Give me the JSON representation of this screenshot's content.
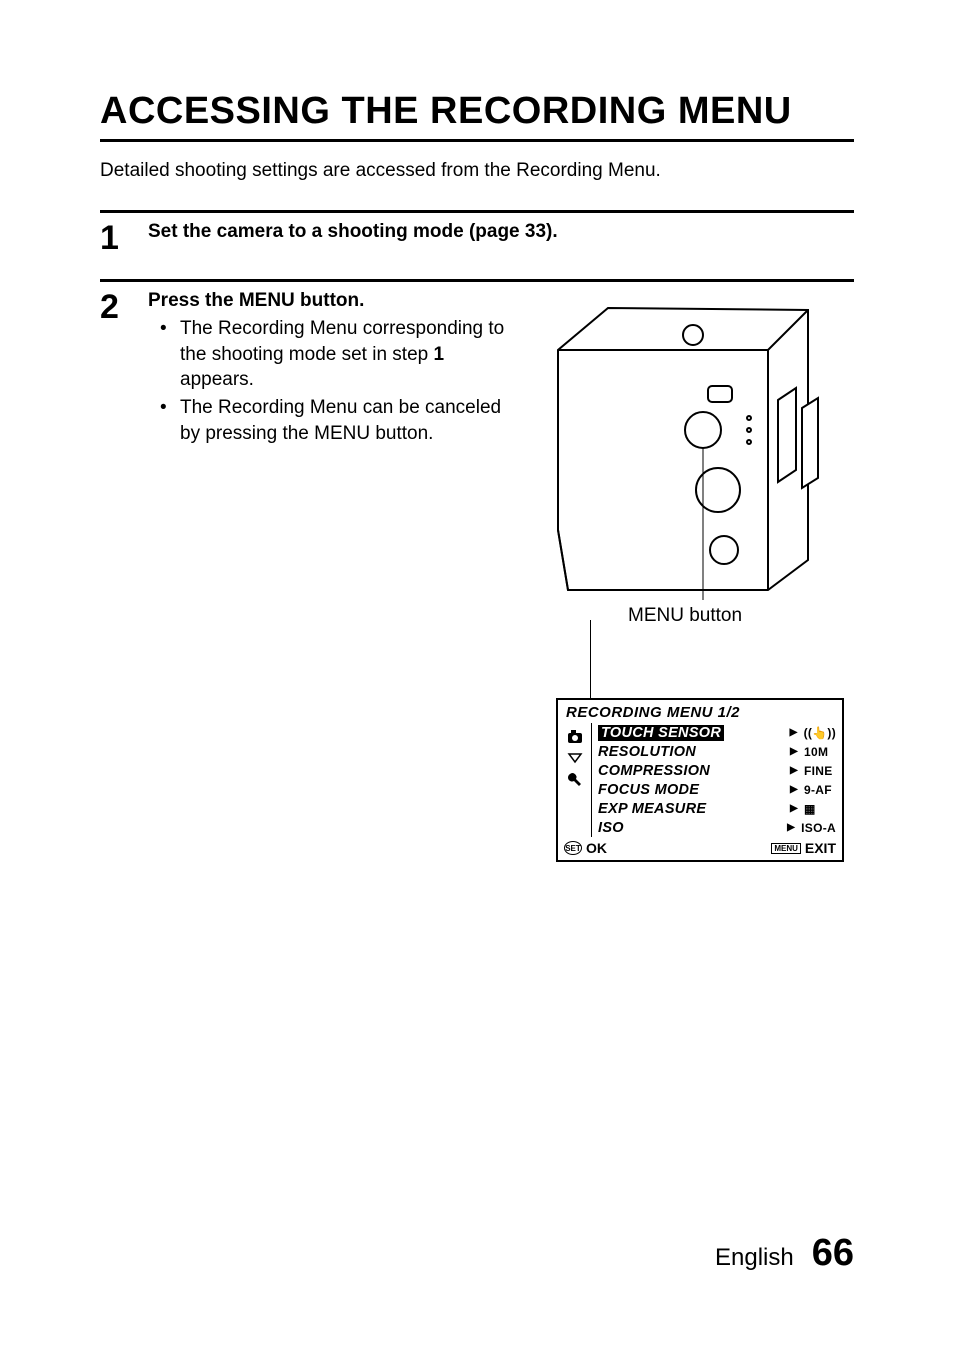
{
  "title": "ACCESSING THE RECORDING MENU",
  "intro": "Detailed shooting settings are accessed from the Recording Menu.",
  "steps": {
    "s1": {
      "num": "1",
      "head": "Set the camera to a shooting mode (page 33)."
    },
    "s2": {
      "num": "2",
      "head": "Press the MENU button.",
      "b1a": "The Recording Menu corresponding to the shooting mode set in step ",
      "b1bold": "1",
      "b1b": " appears.",
      "b2": "The Recording Menu can be canceled by pressing the MENU button."
    }
  },
  "illustration": {
    "menu_label": "MENU button"
  },
  "screen": {
    "title": "RECORDING MENU 1/2",
    "rows": [
      {
        "label": "TOUCH SENSOR",
        "value": "((👆))",
        "selected": true
      },
      {
        "label": "RESOLUTION",
        "value": "10M",
        "selected": false
      },
      {
        "label": "COMPRESSION",
        "value": "FINE",
        "selected": false
      },
      {
        "label": "FOCUS MODE",
        "value": "9-AF",
        "selected": false
      },
      {
        "label": "EXP MEASURE",
        "value": "▦",
        "selected": false
      },
      {
        "label": "ISO",
        "value": "ISO-A",
        "selected": false
      }
    ],
    "foot": {
      "set_label": "SET",
      "ok": "OK",
      "menu_label": "MENU",
      "exit": "EXIT"
    }
  },
  "footer": {
    "lang": "English",
    "page": "66"
  }
}
